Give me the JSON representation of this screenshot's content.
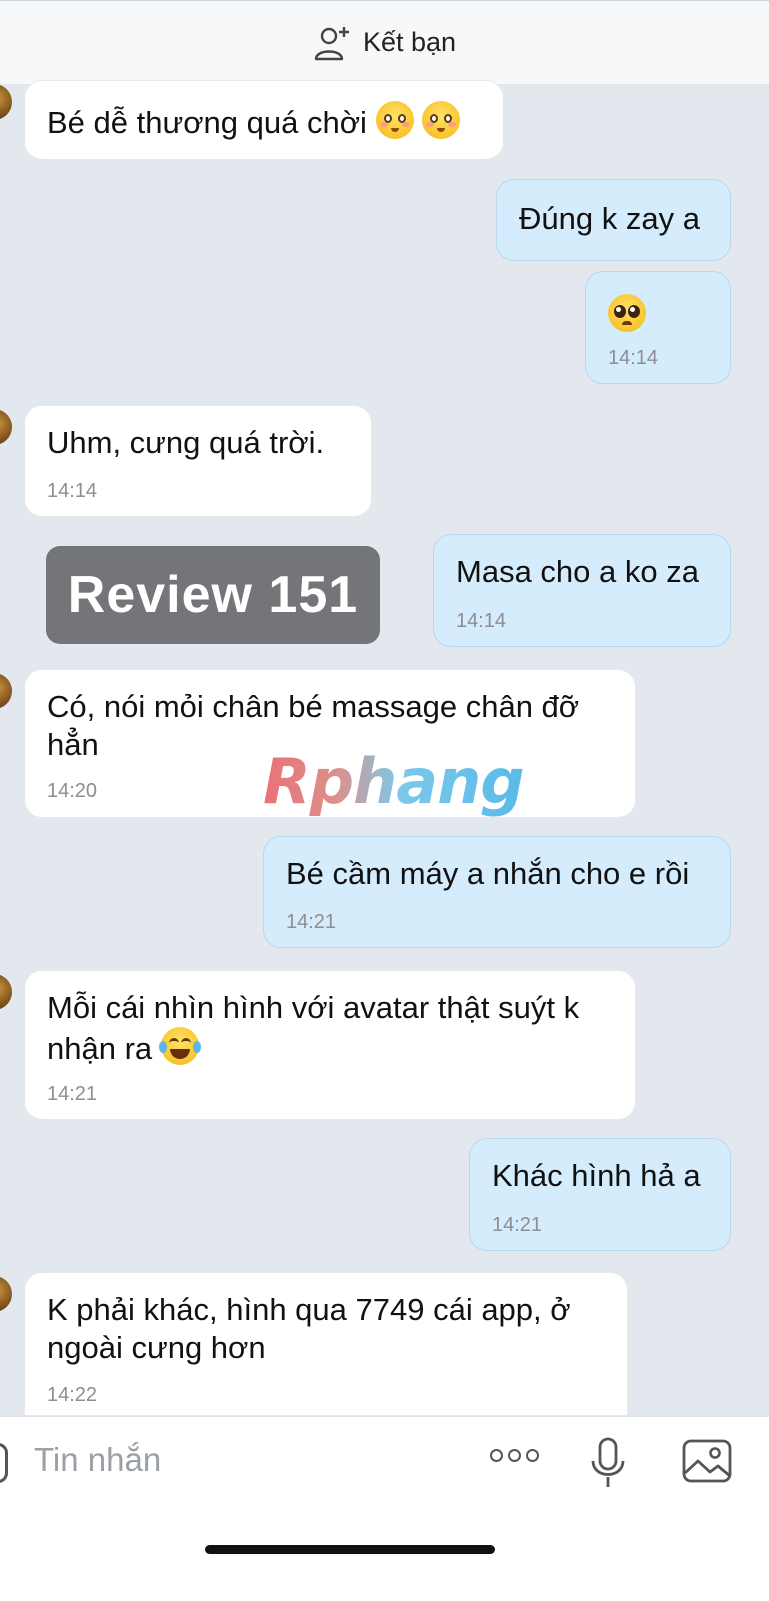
{
  "header": {
    "add_friend_label": "Kết bạn",
    "icon": "add-person-icon"
  },
  "messages": [
    {
      "direction": "incoming",
      "text": "Bé dễ thương quá chời",
      "emojis": [
        "smiling-blush-emoji",
        "smiling-blush-emoji"
      ]
    },
    {
      "direction": "outgoing",
      "text": "Đúng k zay a"
    },
    {
      "direction": "outgoing",
      "emojis": [
        "pleading-face-emoji"
      ],
      "time": "14:14"
    },
    {
      "direction": "incoming",
      "text": "Uhm, cưng quá trời.",
      "time": "14:14"
    },
    {
      "direction": "outgoing",
      "text": "Masa cho a ko za",
      "time": "14:14"
    },
    {
      "direction": "incoming",
      "text": "Có, nói mỏi chân bé massage chân đỡ hẳn",
      "time": "14:20"
    },
    {
      "direction": "outgoing",
      "text": "Bé cầm máy a nhắn cho e rồi",
      "time": "14:21"
    },
    {
      "direction": "incoming",
      "text": "Mỗi cái nhìn hình với avatar thật suýt k nhận ra",
      "emojis": [
        "laughing-tears-emoji"
      ],
      "time": "14:21"
    },
    {
      "direction": "outgoing",
      "text": "Khác hình hả a",
      "time": "14:21"
    },
    {
      "direction": "incoming",
      "text": "K phải khác, hình qua 7749 cái app, ở ngoài cưng hơn",
      "time": "14:22"
    }
  ],
  "overlay": {
    "review_label": "Review 151",
    "watermark": "Rphang"
  },
  "composer": {
    "placeholder": "Tin nhắn",
    "icons": [
      "more-icon",
      "mic-icon",
      "image-icon"
    ]
  },
  "colors": {
    "background": "#e3e8ef",
    "incoming_bubble": "#ffffff",
    "outgoing_bubble": "#d4ecfb",
    "review_badge": "#737578",
    "timestamp": "#8e8e93"
  }
}
